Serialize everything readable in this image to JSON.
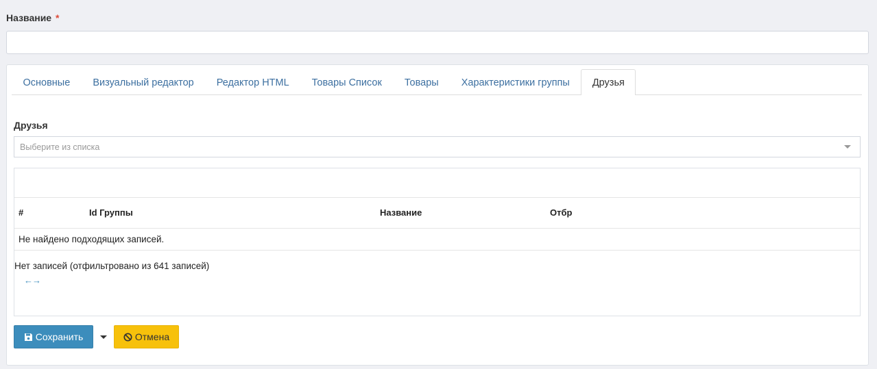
{
  "form": {
    "name_label": "Название",
    "required_mark": "*",
    "name_value": ""
  },
  "tabs": [
    {
      "label": "Основные"
    },
    {
      "label": "Визуальный редактор"
    },
    {
      "label": "Редактор HTML"
    },
    {
      "label": "Товары Список"
    },
    {
      "label": "Товары"
    },
    {
      "label": "Характеристики группы"
    },
    {
      "label": "Друзья"
    }
  ],
  "active_tab": "Друзья",
  "friends": {
    "label": "Друзья",
    "select_placeholder": "Выберите из списка"
  },
  "table": {
    "columns": [
      "#",
      "Id Группы",
      "Название",
      "Отбр"
    ],
    "empty_text": "Не найдено подходящих записей.",
    "info_text": "Нет записей (отфильтровано из 641 записей)",
    "pager_text": "←→"
  },
  "actions": {
    "save_label": "Сохранить",
    "cancel_label": "Отмена"
  },
  "colors": {
    "save_button": "#3c8dbc",
    "cancel_button": "#f7c10b",
    "required": "#dd4b39",
    "tab_link": "#3c6fa0"
  },
  "icons": {
    "save": "floppy-disk-icon",
    "cancel": "ban-icon",
    "dropdown": "caret-down-icon"
  }
}
